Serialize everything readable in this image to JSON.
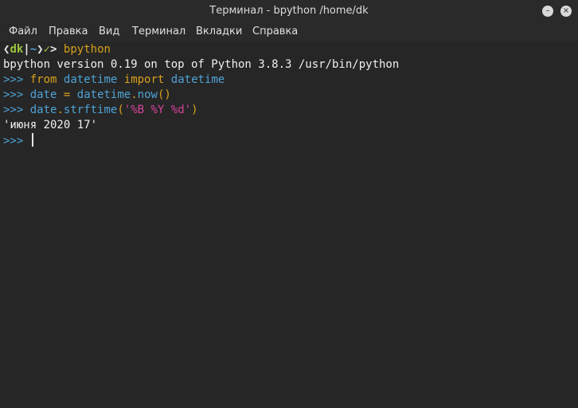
{
  "window": {
    "title": "Терминал - bpython /home/dk",
    "minimize_glyph": "–",
    "close_glyph": "×"
  },
  "menu": [
    "Файл",
    "Правка",
    "Вид",
    "Терминал",
    "Вкладки",
    "Справка"
  ],
  "shell_prompt": {
    "open": "❮",
    "user": "dk",
    "sep": "|",
    "dir": "~",
    "close": "❯",
    "check": "✓",
    "arrow": ">",
    "command": "bpython"
  },
  "terminal": {
    "banner": "bpython version 0.19 on top of Python 3.8.3 /usr/bin/python",
    "prompt": ">>>",
    "line1": {
      "kw1": "from",
      "mod": "datetime",
      "kw2": "import",
      "name": "datetime"
    },
    "line2": {
      "var": "date",
      "eq": "=",
      "obj": "datetime",
      "dot": ".",
      "method": "now",
      "parens": "()"
    },
    "line3": {
      "obj": "date",
      "dot": ".",
      "method": "strftime",
      "open": "(",
      "arg": "'%B %Y %d'",
      "close": ")"
    },
    "output": "'июня 2020 17'"
  },
  "colors": {
    "background": "#262626",
    "prompt_blue": "#4ea3d6",
    "keyword_orange": "#d7a11b",
    "string_magenta": "#d6419b",
    "user_green": "#9bc53d"
  }
}
